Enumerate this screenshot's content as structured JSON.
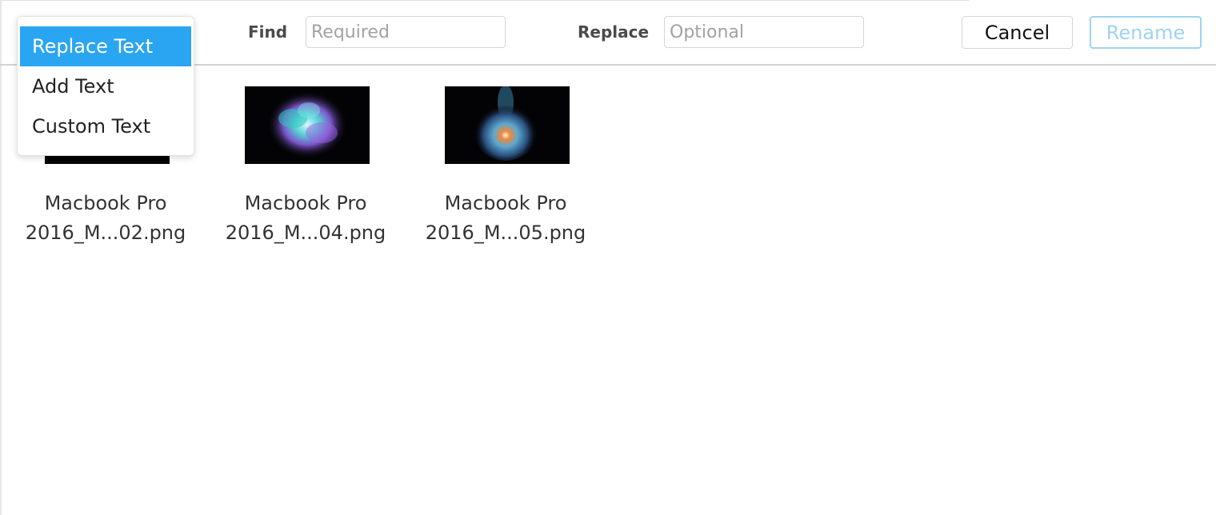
{
  "rename_mode_menu": {
    "items": [
      {
        "label": "Replace Text",
        "selected": true
      },
      {
        "label": "Add Text",
        "selected": false
      },
      {
        "label": "Custom Text",
        "selected": false
      }
    ]
  },
  "find": {
    "label": "Find",
    "value": "",
    "placeholder": "Required"
  },
  "replace": {
    "label": "Replace",
    "value": "",
    "placeholder": "Optional"
  },
  "buttons": {
    "cancel": "Cancel",
    "rename": "Rename"
  },
  "files": [
    {
      "name_line1": "Macbook Pro",
      "name_line2": "2016_M...02.png",
      "thumbnail": "dark-image"
    },
    {
      "name_line1": "Macbook Pro",
      "name_line2": "2016_M...04.png",
      "thumbnail": "teal-purple-color-burst"
    },
    {
      "name_line1": "Macbook Pro",
      "name_line2": "2016_M...05.png",
      "thumbnail": "blue-orange-smoke-burst"
    }
  ],
  "colors": {
    "accent": "#2aa5f2",
    "rename_disabled": "#9fd3f3"
  }
}
